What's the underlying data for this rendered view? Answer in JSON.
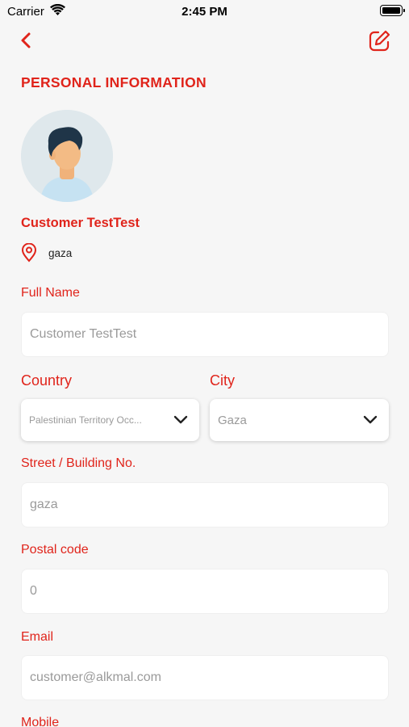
{
  "status_bar": {
    "carrier": "Carrier",
    "time": "2:45 PM"
  },
  "icons": {
    "back": "chevron-left-icon",
    "edit": "edit-icon",
    "location": "map-pin-icon",
    "dropdown": "chevron-down-icon"
  },
  "colors": {
    "accent": "#e0241b",
    "background": "#f6f6f6",
    "field_background": "#ffffff",
    "placeholder": "#9a9a9a"
  },
  "header": {
    "title": "PERSONAL INFORMATION"
  },
  "profile": {
    "name": "Customer TestTest",
    "location": "gaza"
  },
  "form": {
    "full_name": {
      "label": "Full Name",
      "placeholder": "Customer TestTest"
    },
    "country": {
      "label": "Country",
      "value": "Palestinian Territory Occ..."
    },
    "city": {
      "label": "City",
      "value": "Gaza"
    },
    "street": {
      "label": "Street / Building No.",
      "placeholder": "gaza"
    },
    "postal": {
      "label": "Postal code",
      "placeholder": "0"
    },
    "email": {
      "label": "Email",
      "placeholder": "customer@alkmal.com"
    },
    "mobile": {
      "label": "Mobile"
    }
  }
}
